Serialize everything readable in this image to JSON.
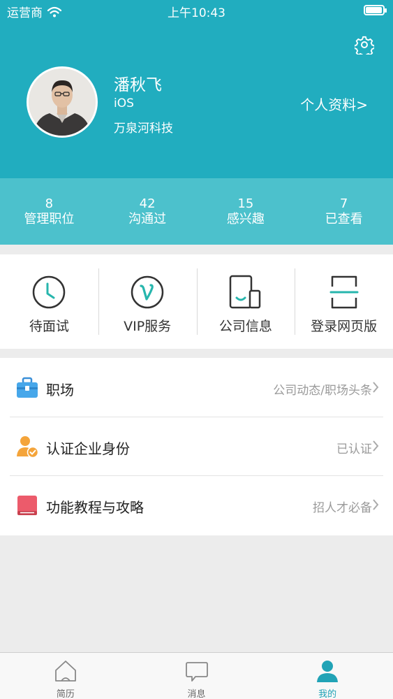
{
  "status_bar": {
    "carrier": "运营商",
    "time": "上午10:43",
    "battery_level": 0.95
  },
  "profile": {
    "name": "潘秋飞",
    "position": "iOS",
    "company": "万泉河科技",
    "profile_link": "个人资料>"
  },
  "stats": [
    {
      "value": "8",
      "label": "管理职位"
    },
    {
      "value": "42",
      "label": "沟通过"
    },
    {
      "value": "15",
      "label": "感兴趣"
    },
    {
      "value": "7",
      "label": "已查看"
    }
  ],
  "quick_actions": [
    {
      "label": "待面试",
      "icon": "clock-icon"
    },
    {
      "label": "VIP服务",
      "icon": "vip-icon"
    },
    {
      "label": "公司信息",
      "icon": "phone-card-icon"
    },
    {
      "label": "登录网页版",
      "icon": "scan-icon"
    }
  ],
  "menu": [
    {
      "title": "职场",
      "detail": "公司动态/职场头条",
      "icon": "briefcase-icon"
    },
    {
      "title": "认证企业身份",
      "detail": "已认证",
      "icon": "verified-user-icon"
    },
    {
      "title": "功能教程与攻略",
      "detail": "招人才必备",
      "icon": "book-icon"
    }
  ],
  "tabs": [
    {
      "label": "简历",
      "icon": "house-icon",
      "active": false
    },
    {
      "label": "消息",
      "icon": "chat-bubble-icon",
      "active": false
    },
    {
      "label": "我的",
      "icon": "person-icon",
      "active": true
    }
  ],
  "colors": {
    "header": "#21adbf",
    "stats_bar": "#4cc1cc",
    "accent": "#21a3b6",
    "teal_icon": "#27b6ad"
  }
}
